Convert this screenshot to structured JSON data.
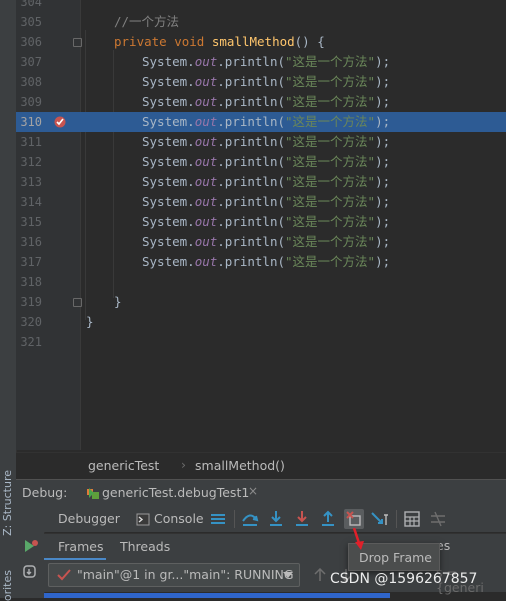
{
  "editor": {
    "lines": [
      {
        "num": "304",
        "kind": "empty"
      },
      {
        "num": "305",
        "kind": "comment",
        "text": "//一个方法"
      },
      {
        "num": "306",
        "kind": "signature",
        "kw1": "private",
        "kw2": "void",
        "fn": "smallMethod",
        "rest": "() {"
      },
      {
        "num": "307",
        "kind": "print",
        "pre": "System.",
        "field": "out",
        "call": ".println(",
        "str": "\"这是一个方法\"",
        "end": ");"
      },
      {
        "num": "308",
        "kind": "print",
        "pre": "System.",
        "field": "out",
        "call": ".println(",
        "str": "\"这是一个方法\"",
        "end": ");"
      },
      {
        "num": "309",
        "kind": "print",
        "pre": "System.",
        "field": "out",
        "call": ".println(",
        "str": "\"这是一个方法\"",
        "end": ");"
      },
      {
        "num": "310",
        "kind": "print",
        "pre": "System.",
        "field": "out",
        "call": ".println(",
        "str": "\"这是一个方法\"",
        "end": ");",
        "highlight": true,
        "breakpoint": true
      },
      {
        "num": "311",
        "kind": "print",
        "pre": "System.",
        "field": "out",
        "call": ".println(",
        "str": "\"这是一个方法\"",
        "end": ");"
      },
      {
        "num": "312",
        "kind": "print",
        "pre": "System.",
        "field": "out",
        "call": ".println(",
        "str": "\"这是一个方法\"",
        "end": ");"
      },
      {
        "num": "313",
        "kind": "print",
        "pre": "System.",
        "field": "out",
        "call": ".println(",
        "str": "\"这是一个方法\"",
        "end": ");"
      },
      {
        "num": "314",
        "kind": "print",
        "pre": "System.",
        "field": "out",
        "call": ".println(",
        "str": "\"这是一个方法\"",
        "end": ");"
      },
      {
        "num": "315",
        "kind": "print",
        "pre": "System.",
        "field": "out",
        "call": ".println(",
        "str": "\"这是一个方法\"",
        "end": ");"
      },
      {
        "num": "316",
        "kind": "print",
        "pre": "System.",
        "field": "out",
        "call": ".println(",
        "str": "\"这是一个方法\"",
        "end": ");"
      },
      {
        "num": "317",
        "kind": "print",
        "pre": "System.",
        "field": "out",
        "call": ".println(",
        "str": "\"这是一个方法\"",
        "end": ");"
      },
      {
        "num": "318",
        "kind": "empty"
      },
      {
        "num": "319",
        "kind": "brace",
        "text": "}"
      },
      {
        "num": "320",
        "kind": "brace-outer",
        "text": "}"
      },
      {
        "num": "321",
        "kind": "empty"
      }
    ]
  },
  "breadcrumb": {
    "class_name": "genericTest",
    "separator": "›",
    "method_name": "smallMethod()"
  },
  "debug": {
    "label": "Debug:",
    "session_tab": "genericTest.debugTest1",
    "close": "×",
    "debugger_tab": "Debugger",
    "console_tab": "Console",
    "frames_tab": "Frames",
    "threads_tab": "Threads",
    "thread_value": "\"main\"@1 in gr...\"main\": RUNNING",
    "vars_label": "es",
    "vars_faint": "s = {generi",
    "tooltip": "Drop Frame"
  },
  "sidebar": {
    "structure_tab": "Z: Structure",
    "favorites_tab": "orites"
  },
  "watermark": "CSDN @1596267857",
  "colors": {
    "highlight": "#2d5b94",
    "keyword": "#cc7832",
    "method": "#ffc66d",
    "string": "#6a8759",
    "field": "#9876aa",
    "accent": "#4a88c7",
    "red": "#c75450"
  }
}
